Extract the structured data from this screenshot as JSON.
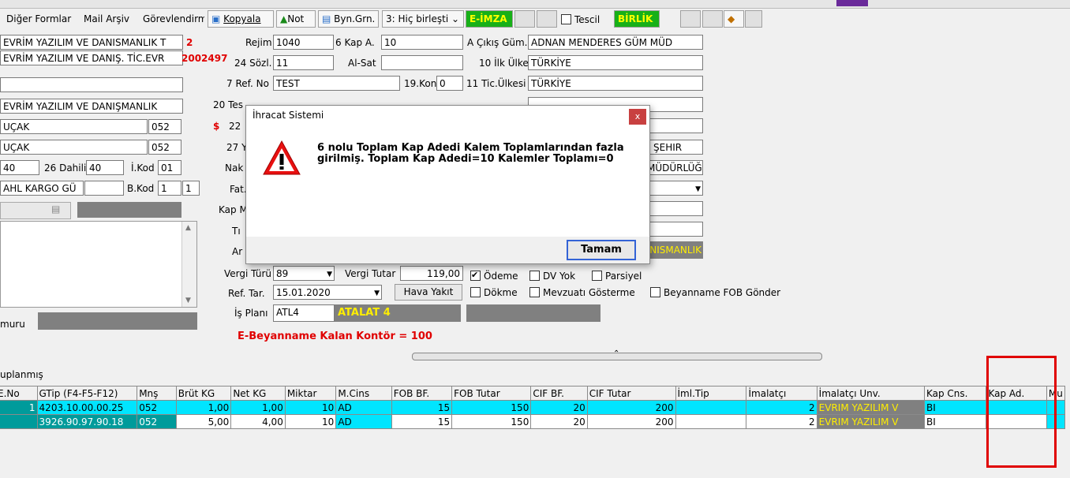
{
  "toolbar": {
    "digerformlar": "Diğer Formlar",
    "mailarsiv": "Mail Arşiv",
    "gorevlendirme": "Görevlendirme",
    "kopyala": "Kopyala",
    "not": "Not",
    "byngrn": "Byn.Grn.",
    "birlesti": "3: Hiç birleşti",
    "eimza": "E-İMZA",
    "tescil": "Tescil",
    "birlik": "BİRLİK"
  },
  "left": {
    "firm1": "EVRİM YAZILIM VE DANISMANLIK T",
    "firm1_code": "2",
    "firm2": "EVRİM YAZILIM VE DANIŞ. TİC.EVR",
    "firm2_code": "2002497",
    "blank": "",
    "firm3": "EVRİM YAZILIM VE DANIŞMANLIK",
    "ucak1": "UÇAK",
    "ucak1_code": "052",
    "ucak2": "UÇAK",
    "ucak2_code": "052",
    "v40": "40",
    "dahili_label": "26 Dahili",
    "dahili": "40",
    "ikod_label": "İ.Kod",
    "ikod": "01",
    "kargo": "AHL KARGO GÜ",
    "bkod_label": "B.Kod",
    "bkod": "1",
    "bkod2": "1",
    "muru": "muru"
  },
  "mid": {
    "rejim_label": "Rejim",
    "rejim": "1040",
    "kapa_label": "6 Kap A.",
    "kapa": "10",
    "sozl_label": "24 Sözl.",
    "sozl": "11",
    "alsat_label": "Al-Sat",
    "alsat": "",
    "refno_label": "7 Ref. No",
    "refno": "TEST",
    "kont_label": "19.Kont.",
    "kont": "0",
    "tes_label": "20 Tes",
    "dollar": "$",
    "n22": "22",
    "yu_label": "27 Yü",
    "nak_label": "Nak",
    "fat_label": "Fat.",
    "kapm_label": "Kap M",
    "ti_label": "Tı",
    "ar_label": "Ar",
    "vergiturlabel": "Vergi Türü",
    "vergitur": "89",
    "vergitutar_label": "Vergi Tutar",
    "vergitutar": "119,00",
    "reftar_label": "Ref. Tar.",
    "reftar": "15.01.2020",
    "havayakit": "Hava Yakıt",
    "isplani_label": "İş Planı",
    "isplani": "ATL4",
    "atalat": "ATALAT 4",
    "ebeyan": "E-Beyanname Kalan Kontör = 100"
  },
  "right": {
    "cikis_label": "A Çıkış Güm.",
    "cikis": "ADNAN MENDERES GÜM MÜD",
    "ilkulke_label": "10 İlk Ülke",
    "ilkulke": "TÜRKİYE",
    "ticulke_label": "11 Tic.Ülkesi",
    "ticulke": "TÜRKİYE",
    "sehir": "ŞEHIR",
    "mudurlugu": "MÜDÜRLÜĞ",
    "nismanlik": "NISMANLIK",
    "odeme": "Ödeme",
    "dvyok": "DV Yok",
    "parsiyel": "Parsiyel",
    "dokme": "Dökme",
    "mevzuati": "Mevzuatı Gösterme",
    "fob": "Beyanname FOB Gönder"
  },
  "dialog": {
    "title": "İhracat Sistemi",
    "close": "x",
    "line1": "6 nolu Toplam Kap Adedi Kalem Toplamlarından fazla",
    "line2": "girilmiş. Toplam Kap Adedi=10 Kalemler Toplamı=0",
    "ok": "Tamam"
  },
  "grid": {
    "caption": "uplanmış",
    "headers": [
      "E.No",
      "GTip (F4-F5-F12)",
      "Mnş",
      "Brüt KG",
      "Net KG",
      "Miktar",
      "M.Cins",
      "FOB BF.",
      "FOB Tutar",
      "CIF BF.",
      "CIF Tutar",
      "İml.Tip",
      "İmalatçı",
      "İmalatçı Unv.",
      "Kap Cns.",
      "Kap Ad.",
      "Mu"
    ],
    "rows": [
      [
        "1",
        "4203.10.00.00.25",
        "052",
        "1,00",
        "1,00",
        "10",
        "AD",
        "15",
        "150",
        "20",
        "200",
        "",
        "2",
        "EVRIM YAZILIM V",
        "BI",
        "",
        ""
      ],
      [
        "",
        "3926.90.97.90.18",
        "052",
        "5,00",
        "4,00",
        "10",
        "AD",
        "15",
        "150",
        "20",
        "200",
        "",
        "2",
        "EVRIM YAZILIM V",
        "BI",
        "",
        ""
      ]
    ]
  },
  "colors": {
    "highlight": "#e00000",
    "accent_green": "#18b018",
    "cyan": "#00e5ff"
  }
}
